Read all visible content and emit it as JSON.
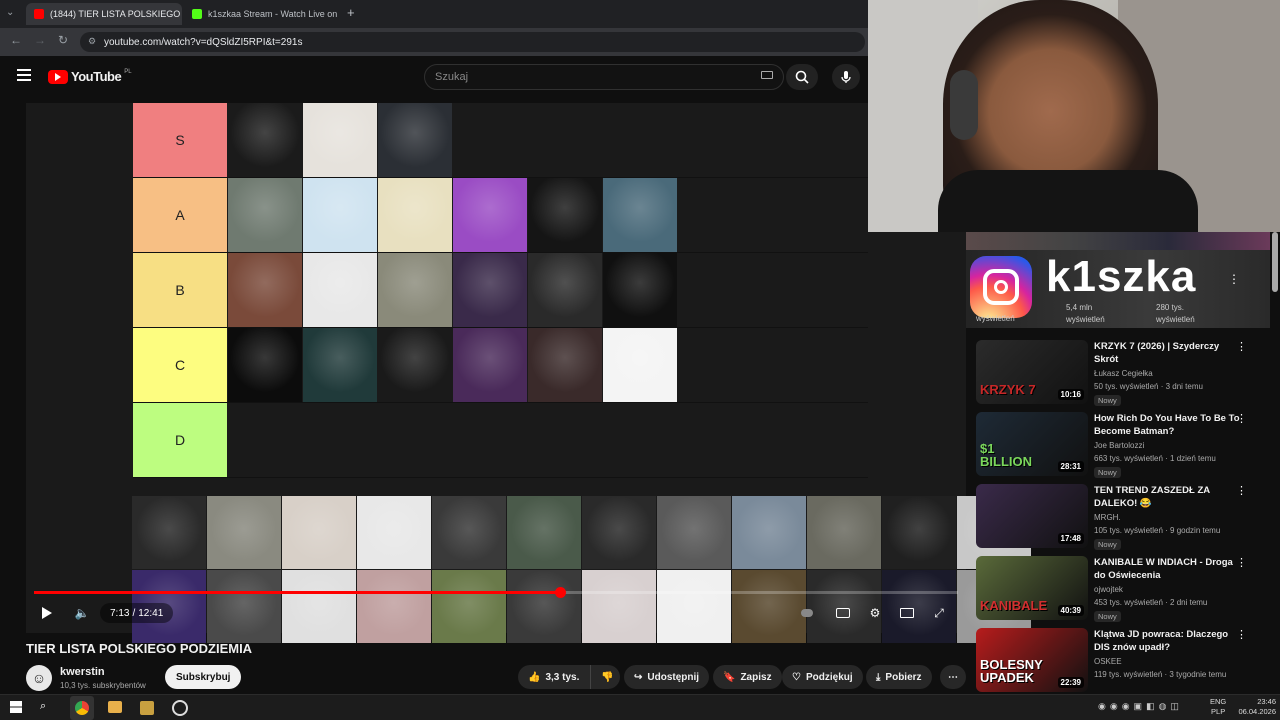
{
  "browser": {
    "tabs": [
      {
        "label": "(1844) TIER LISTA POLSKIEGO P",
        "active": true
      },
      {
        "label": "k1szkaa Stream - Watch Live on",
        "active": false
      }
    ],
    "new_tab": "+",
    "url": "youtube.com/watch?v=dQSldZI5RPI&t=291s"
  },
  "youtube": {
    "logo_text": "YouTube",
    "region": "PL",
    "search_placeholder": "Szukaj"
  },
  "tierlist": {
    "tiers": [
      {
        "label": "S",
        "color": "#f07f80",
        "count": 3
      },
      {
        "label": "A",
        "color": "#f7bf84",
        "count": 6
      },
      {
        "label": "B",
        "color": "#f7df84",
        "count": 6
      },
      {
        "label": "C",
        "color": "#fdfd80",
        "count": 6
      },
      {
        "label": "D",
        "color": "#bdfd80",
        "count": 0
      }
    ]
  },
  "player": {
    "current_time": "7:13",
    "duration": "12:41",
    "progress_fraction": 0.569
  },
  "video": {
    "title": "TIER LISTA POLSKIEGO PODZIEMIA",
    "channel": "kwerstin",
    "subscribers": "10,3 tys. subskrybentów",
    "subscribe_label": "Subskrybuj",
    "likes": "3,3 tys.",
    "share_label": "Udostępnij",
    "save_label": "Zapisz",
    "thanks_label": "Podziękuj",
    "download_label": "Pobierz"
  },
  "instagram_card": {
    "name": "k1szka",
    "stats": [
      "wyświetleń",
      "5,4 mln wyświetleń",
      "280 tys. wyświetleń"
    ]
  },
  "recommendations": [
    {
      "title": "KRZYK 7 (2026) | Szyderczy Skrót",
      "channel": "Łukasz Cegiełka",
      "meta": "50 tys. wyświetleń · 3 dni temu",
      "badge": "Nowy",
      "duration": "10:16",
      "thumb_text": "KRZYK 7",
      "thumb_bg": "#2b2b2b",
      "thumb_accent": "#c62828"
    },
    {
      "title": "How Rich Do You Have To Be To Become Batman?",
      "channel": "Joe Bartolozzi",
      "meta": "663 tys. wyświetleń · 1 dzień temu",
      "badge": "Nowy",
      "duration": "28:31",
      "thumb_text": "$1 BILLION",
      "thumb_bg": "#1e2a36",
      "thumb_accent": "#7bd85c"
    },
    {
      "title": "TEN TREND ZASZEDŁ ZA DALEKO! 😂",
      "channel": "MRGH.",
      "meta": "105 tys. wyświetleń · 9 godzin temu",
      "badge": "Nowy",
      "duration": "17:48",
      "thumb_text": "",
      "thumb_bg": "#3a2a4a",
      "thumb_accent": "#e91e63"
    },
    {
      "title": "KANIBALE W INDIACH - Droga do Oświecenia",
      "channel": "ojwojtek",
      "meta": "453 tys. wyświetleń · 2 dni temu",
      "badge": "Nowy",
      "duration": "40:39",
      "thumb_text": "KANIBALE",
      "thumb_bg": "#5a6a3a",
      "thumb_accent": "#d32f2f"
    },
    {
      "title": "Klątwa JD powraca: Dlaczego DIS znów upadł?",
      "channel": "OSKEE",
      "meta": "119 tys. wyświetleń · 3 tygodnie temu",
      "badge": "",
      "duration": "22:39",
      "thumb_text": "BOLESNY UPADEK",
      "thumb_bg": "#b71c1c",
      "thumb_accent": "#ffffff"
    }
  ],
  "taskbar": {
    "lang_top": "ENG",
    "lang_bottom": "PLP",
    "time": "23:46",
    "date": "06.04.2026"
  }
}
